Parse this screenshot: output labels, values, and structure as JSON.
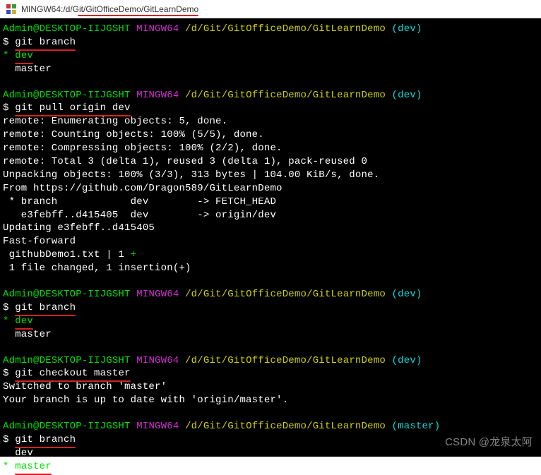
{
  "titlebar": {
    "path": "MINGW64:/d/Git/GitOfficeDemo/GitLearnDemo"
  },
  "prompt": {
    "userhost": "Admin@DESKTOP-IIJGSHT",
    "shell": "MINGW64",
    "cwd": "/d/Git/GitOfficeDemo/GitLearnDemo",
    "branch_dev": "(dev)",
    "branch_master": "(master)",
    "dollar": "$"
  },
  "cmd": {
    "git_branch": "git branch",
    "git_pull_origin_dev": "git pull origin dev",
    "git_checkout_master": "git checkout master"
  },
  "branch_list": {
    "star": "*",
    "dev": "dev",
    "master": "master",
    "dev_indented": "  dev",
    "master_indented": "  master"
  },
  "pull_output": {
    "l1": "remote: Enumerating objects: 5, done.",
    "l2": "remote: Counting objects: 100% (5/5), done.",
    "l3": "remote: Compressing objects: 100% (2/2), done.",
    "l4": "remote: Total 3 (delta 1), reused 3 (delta 1), pack-reused 0",
    "l5": "Unpacking objects: 100% (3/3), 313 bytes | 104.00 KiB/s, done.",
    "l6": "From https://github.com/Dragon589/GitLearnDemo",
    "l7": " * branch            dev        -> FETCH_HEAD",
    "l8": "   e3febff..d415405  dev        -> origin/dev",
    "l9": "Updating e3febff..d415405",
    "l10": "Fast-forward",
    "l11a": " githubDemo1.txt | 1 ",
    "l11b": "+",
    "l12": " 1 file changed, 1 insertion(+)"
  },
  "checkout_output": {
    "l1": "Switched to branch 'master'",
    "l2": "Your branch is up to date with 'origin/master'."
  },
  "watermark": "CSDN @龙泉太阿"
}
